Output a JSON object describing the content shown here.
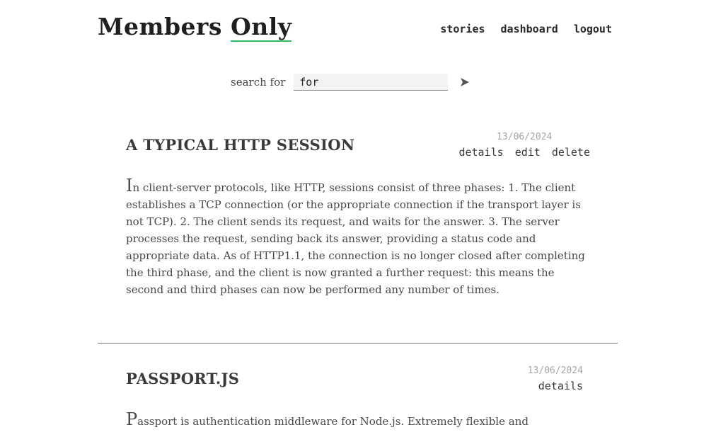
{
  "header": {
    "brand_main": "Members",
    "brand_accent": "Only",
    "nav": {
      "stories": "stories",
      "dashboard": "dashboard",
      "logout": "logout"
    }
  },
  "search": {
    "label": "search for",
    "value": "for",
    "submit_icon": "arrow-right-icon"
  },
  "stories": [
    {
      "title": "A TYPICAL HTTP SESSION",
      "date": "13/06/2024",
      "actions": {
        "details": "details",
        "edit": "edit",
        "delete": "delete"
      },
      "body": "In client-server protocols, like HTTP, sessions consist of three phases: 1. The client establishes a TCP connection (or the appropriate connection if the transport layer is not TCP). 2. The client sends its request, and waits for the answer. 3. The server processes the request, sending back its answer, providing a status code and appropriate data. As of HTTP1.1, the connection is no longer closed after completing the third phase, and the client is now granted a further request: this means the second and third phases can now be performed any number of times."
    },
    {
      "title": "PASSPORT.JS",
      "date": "13/06/2024",
      "actions": {
        "details": "details"
      },
      "body": "Passport is authentication middleware for Node.js. Extremely flexible and"
    }
  ],
  "colors": {
    "accent_underline": "#2ebd5f",
    "date_gray": "#a6a6a6",
    "divider": "#777777"
  }
}
